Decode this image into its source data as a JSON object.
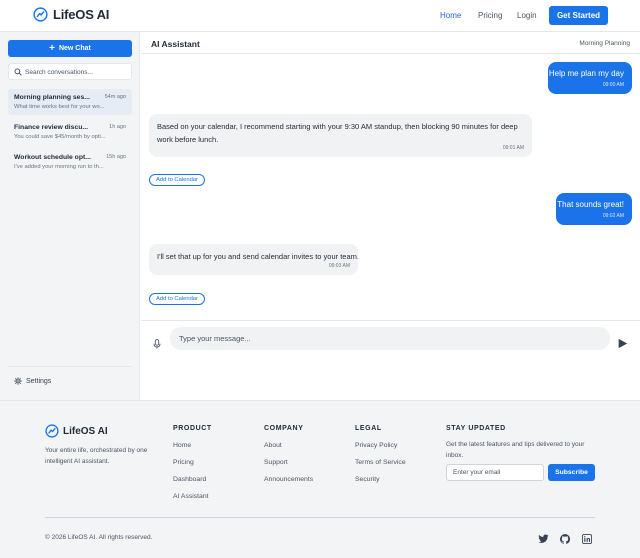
{
  "header": {
    "brand": "LifeOS AI",
    "nav": {
      "home": "Home",
      "pricing": "Pricing",
      "login": "Login"
    },
    "cta": "Get Started"
  },
  "sidebar": {
    "new_chat": "New Chat",
    "search_placeholder": "Search conversations...",
    "conversations": [
      {
        "title": "Morning planning ses...",
        "time": "54m ago",
        "preview": "What time works best for your wo...",
        "active": true
      },
      {
        "title": "Finance review discu...",
        "time": "1h ago",
        "preview": "You could save $45/month by opti..."
      },
      {
        "title": "Workout schedule opt...",
        "time": "15h ago",
        "preview": "I've added your morning run to th..."
      }
    ],
    "settings": "Settings"
  },
  "chat": {
    "title": "AI Assistant",
    "subtitle": "Morning Planning",
    "messages": [
      {
        "role": "user",
        "text": "Help me plan my day",
        "time": "09:00 AM"
      },
      {
        "role": "assistant",
        "text": "Based on your calendar, I recommend starting with your 9:30 AM standup, then blocking 90 minutes for deep work before lunch.",
        "time": "09:01 AM",
        "action": "Add to Calendar"
      },
      {
        "role": "user",
        "text": "That sounds great!",
        "time": "09:02 AM"
      },
      {
        "role": "assistant",
        "text": "I'll set that up for you and send calendar invites to your team.",
        "time": "09:03 AM",
        "action": "Add to Calendar"
      }
    ],
    "input_placeholder": "Type your message..."
  },
  "footer": {
    "brand": "LifeOS AI",
    "tagline": "Your entire life, orchestrated by one intelligent AI assistant.",
    "columns": [
      {
        "title": "PRODUCT",
        "links": [
          "Home",
          "Pricing",
          "Dashboard",
          "AI Assistant"
        ]
      },
      {
        "title": "COMPANY",
        "links": [
          "About",
          "Support",
          "Announcements"
        ]
      },
      {
        "title": "LEGAL",
        "links": [
          "Privacy Policy",
          "Terms of Service",
          "Security"
        ]
      }
    ],
    "newsletter": {
      "title": "STAY UPDATED",
      "description": "Get the latest features and tips delivered to your inbox.",
      "email_placeholder": "Enter your email",
      "button": "Subscribe"
    },
    "copyright": "© 2026 LifeOS AI. All rights reserved.",
    "social": [
      "twitter-icon",
      "github-icon",
      "linkedin-icon"
    ]
  },
  "colors": {
    "accent": "#1a73e8",
    "sidebar_bg": "#f3f4f6",
    "bubble_ai": "#f1f2f4"
  }
}
